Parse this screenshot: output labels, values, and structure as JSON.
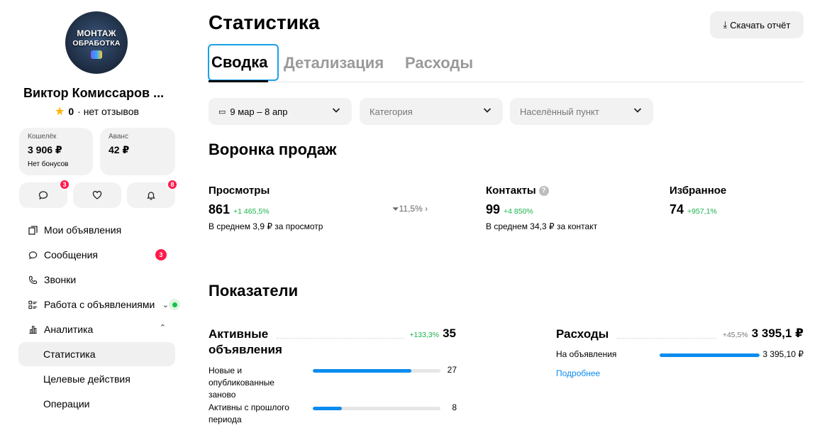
{
  "profile": {
    "avatar_text_line1": "МОНТАЖ",
    "avatar_text_line2": "ОБРАБОТКА",
    "name": "Виктор Комиссаров ...",
    "rating_value": "0",
    "rating_text": "· нет отзывов"
  },
  "wallets": [
    {
      "label": "Кошелёк",
      "value": "3 906 ₽",
      "sub": "Нет бонусов"
    },
    {
      "label": "Аванс",
      "value": "42 ₽",
      "sub": ""
    }
  ],
  "quick_buttons": [
    {
      "icon": "chat-icon",
      "badge": "3"
    },
    {
      "icon": "heart-icon",
      "badge": ""
    },
    {
      "icon": "bell-icon",
      "badge": "8"
    }
  ],
  "nav": [
    {
      "label": "Мои объявления",
      "icon": "ads-icon"
    },
    {
      "label": "Сообщения",
      "icon": "chat-icon",
      "badge": "3"
    },
    {
      "label": "Звонки",
      "icon": "phone-icon"
    },
    {
      "label": "Работа с объявлениями",
      "icon": "list-icon"
    },
    {
      "label": "Аналитика",
      "icon": "analytics-icon"
    },
    {
      "label": "Статистика"
    },
    {
      "label": "Целевые действия"
    },
    {
      "label": "Операции"
    }
  ],
  "page": {
    "title": "Статистика",
    "download_label": "Скачать отчёт"
  },
  "tabs": [
    "Сводка",
    "Детализация",
    "Расходы"
  ],
  "filters": {
    "date": "9 мар – 8 апр",
    "category": "Категория",
    "city": "Населённый пункт"
  },
  "funnel": {
    "title": "Воронка продаж",
    "views": {
      "title": "Просмотры",
      "value": "861",
      "delta": "+1 465,5%",
      "avg": "В среднем 3,9 ₽ за просмотр"
    },
    "conversion": "11,5%",
    "contacts": {
      "title": "Контакты",
      "value": "99",
      "delta": "+4 850%",
      "avg": "В среднем 34,3 ₽ за контакт"
    },
    "favorites": {
      "title": "Избранное",
      "value": "74",
      "delta": "+957,1%"
    }
  },
  "indicators": {
    "title": "Показатели",
    "active": {
      "title": "Активные объявления",
      "delta": "+133,3%",
      "value": "35",
      "rows": [
        {
          "label": "Новые и опубликованные заново",
          "value": "27",
          "fraction": 0.77
        },
        {
          "label": "Активны с прошлого периода",
          "value": "8",
          "fraction": 0.23
        }
      ]
    },
    "expenses": {
      "title": "Расходы",
      "delta": "+45,5%",
      "value": "3 395,1 ₽",
      "rows": [
        {
          "label": "На объявления",
          "value": "3 395,10 ₽",
          "fraction": 1.0
        }
      ],
      "more_link": "Подробнее"
    }
  },
  "colors": {
    "accent": "#0a8cf0",
    "positive": "#17b24a",
    "badge": "#ff1a4b",
    "tab_focus": "#1aa0e8"
  }
}
